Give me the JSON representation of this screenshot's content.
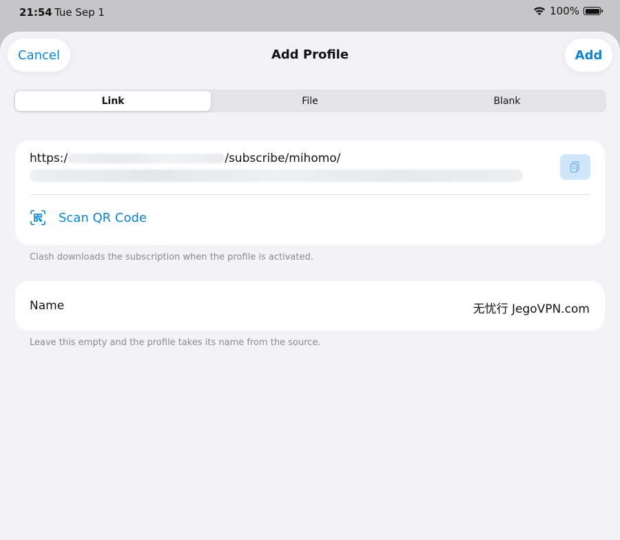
{
  "status_bar": {
    "time": "21:54",
    "date": "Tue Sep 1",
    "battery": "100%",
    "icons": [
      "wifi-icon",
      "battery-icon"
    ]
  },
  "nav": {
    "cancel_label": "Cancel",
    "title": "Add Profile",
    "add_label": "Add"
  },
  "segments": {
    "items": [
      "Link",
      "File",
      "Blank"
    ],
    "selected": "Link"
  },
  "link_section": {
    "url_prefix": "https:/",
    "url_suffix": "/subscribe/mihomo/",
    "paste_icon": "clipboard-icon",
    "scan_icon": "qr-scan-icon",
    "scan_label": "Scan QR Code",
    "footnote": "Clash downloads the subscription when the profile is activated."
  },
  "name_section": {
    "label": "Name",
    "value": "无忧行 JegoVPN.com",
    "footnote": "Leave this empty and the profile takes its name from the source."
  },
  "colors": {
    "accent": "#0a84d6",
    "sheet_background": "#f2f2f7",
    "card_background": "#ffffff",
    "paste_button": "#cfe6fb",
    "footnote_text": "#8a8a8e"
  }
}
